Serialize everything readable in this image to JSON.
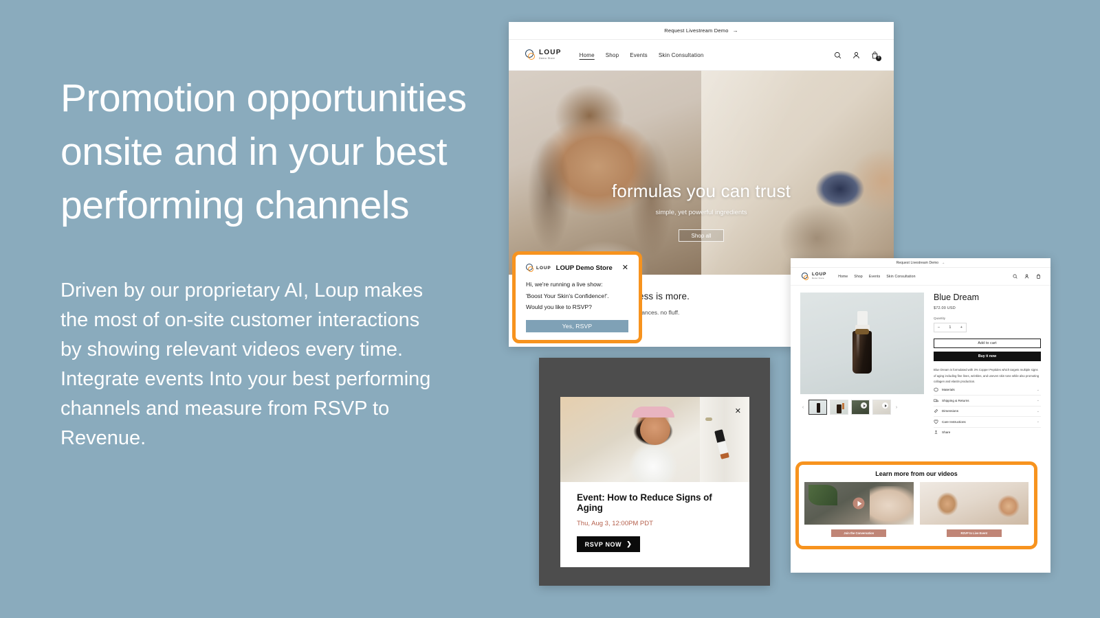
{
  "marketing": {
    "headline": "Promotion opportunities onsite and in your best performing channels",
    "body": "Driven by our proprietary AI, Loup makes the most of on-site customer interactions by showing relevant videos every time. Integrate events Into your best performing channels and measure from RSVP to Revenue."
  },
  "colors": {
    "background": "#8aabbd",
    "highlight_orange": "#F7931E",
    "rsvp_button_blue": "#7fa1b6",
    "event_date_red": "#b5604c",
    "video_button_rose": "#c08576"
  },
  "home_window": {
    "announcement": "Request Livestream Demo",
    "announcement_arrow": "→",
    "brand_name": "LOUP",
    "brand_sub": "Demo Store",
    "nav_links": [
      "Home",
      "Shop",
      "Events",
      "Skin Consultation"
    ],
    "active_link": "Home",
    "icons": [
      "search-icon",
      "account-icon",
      "cart-icon"
    ],
    "cart_count": "0",
    "hero": {
      "title": "formulas you can trust",
      "subtitle": "simple, yet powerful ingredients",
      "button": "Shop all"
    },
    "less_is_more": {
      "title": "sometimes, less is more.",
      "subtitle": "no parabens. no fragrances. no fluff."
    }
  },
  "rsvp_popup": {
    "logo_word": "LOUP",
    "title": "LOUP Demo Store",
    "close": "✕",
    "lines": [
      "Hi, we're running a live show:",
      "'Boost Your Skin's Confidence!'.",
      "Would you like to RSVP?"
    ],
    "button": "Yes, RSVP"
  },
  "pdp_window": {
    "announcement": "Request Livestream Demo",
    "announcement_arrow": "→",
    "brand_name": "LOUP",
    "brand_sub": "Demo Store",
    "nav_links": [
      "Home",
      "Shop",
      "Events",
      "Skin Consultation"
    ],
    "product": {
      "title": "Blue Dream",
      "price": "$72.00 USD",
      "quantity_label": "Quantity",
      "quantity_minus": "–",
      "quantity_value": "1",
      "quantity_plus": "+",
      "add_to_cart": "Add to cart",
      "buy_it_now": "Buy it now",
      "description": "Blue Dream is formulated with 3% Copper Peptides which targets multiple signs of aging including fine lines, wrinkles, and uneven skin tone while also promoting collagen and elastin production."
    },
    "accordions": [
      {
        "label": "Materials",
        "icon": "box-icon"
      },
      {
        "label": "Shipping & Returns",
        "icon": "truck-icon"
      },
      {
        "label": "Dimensions",
        "icon": "ruler-icon"
      },
      {
        "label": "Care Instructions",
        "icon": "heart-icon"
      }
    ],
    "share": {
      "label": "Share",
      "icon": "share-icon"
    },
    "gallery_prev": "‹",
    "gallery_next": "›"
  },
  "videos_section": {
    "title": "Learn more from our videos",
    "cards": [
      {
        "button": "Join the Conversation",
        "has_play": true
      },
      {
        "button": "RSVP to Live Event",
        "has_play": false
      }
    ]
  },
  "event_modal": {
    "close": "✕",
    "title": "Event: How to Reduce Signs of Aging",
    "date": "Thu, Aug 3, 12:00PM PDT",
    "button": "RSVP NOW",
    "button_arrow": "❯"
  }
}
